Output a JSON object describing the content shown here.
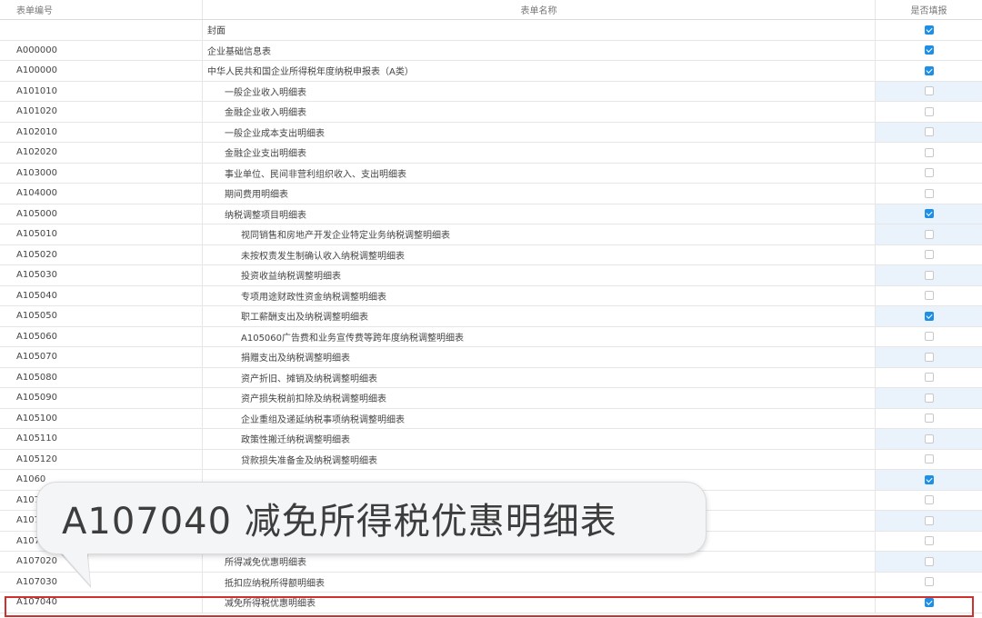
{
  "header": {
    "code": "表单编号",
    "name": "表单名称",
    "filled": "是否填报"
  },
  "rows": [
    {
      "code": "",
      "name": "封面",
      "level": 0,
      "checked": true
    },
    {
      "code": "A000000",
      "name": "企业基础信息表",
      "level": 0,
      "checked": true
    },
    {
      "code": "A100000",
      "name": "中华人民共和国企业所得税年度纳税申报表（A类）",
      "level": 0,
      "checked": true
    },
    {
      "code": "A101010",
      "name": "一般企业收入明细表",
      "level": 1,
      "checked": false
    },
    {
      "code": "A101020",
      "name": "金融企业收入明细表",
      "level": 1,
      "checked": false
    },
    {
      "code": "A102010",
      "name": "一般企业成本支出明细表",
      "level": 1,
      "checked": false
    },
    {
      "code": "A102020",
      "name": "金融企业支出明细表",
      "level": 1,
      "checked": false
    },
    {
      "code": "A103000",
      "name": "事业单位、民间非营利组织收入、支出明细表",
      "level": 1,
      "checked": false
    },
    {
      "code": "A104000",
      "name": "期间费用明细表",
      "level": 1,
      "checked": false
    },
    {
      "code": "A105000",
      "name": "纳税调整项目明细表",
      "level": 1,
      "checked": true
    },
    {
      "code": "A105010",
      "name": "视同销售和房地产开发企业特定业务纳税调整明细表",
      "level": 2,
      "checked": false
    },
    {
      "code": "A105020",
      "name": "未按权责发生制确认收入纳税调整明细表",
      "level": 2,
      "checked": false
    },
    {
      "code": "A105030",
      "name": "投资收益纳税调整明细表",
      "level": 2,
      "checked": false
    },
    {
      "code": "A105040",
      "name": "专项用途财政性资金纳税调整明细表",
      "level": 2,
      "checked": false
    },
    {
      "code": "A105050",
      "name": "职工薪酬支出及纳税调整明细表",
      "level": 2,
      "checked": true
    },
    {
      "code": "A105060",
      "name": "A105060广告费和业务宣传费等跨年度纳税调整明细表",
      "level": 2,
      "checked": false
    },
    {
      "code": "A105070",
      "name": "捐赠支出及纳税调整明细表",
      "level": 2,
      "checked": false
    },
    {
      "code": "A105080",
      "name": "资产折旧、摊销及纳税调整明细表",
      "level": 2,
      "checked": false
    },
    {
      "code": "A105090",
      "name": "资产损失税前扣除及纳税调整明细表",
      "level": 2,
      "checked": false
    },
    {
      "code": "A105100",
      "name": "企业重组及递延纳税事项纳税调整明细表",
      "level": 2,
      "checked": false
    },
    {
      "code": "A105110",
      "name": "政策性搬迁纳税调整明细表",
      "level": 2,
      "checked": false
    },
    {
      "code": "A105120",
      "name": "贷款损失准备金及纳税调整明细表",
      "level": 2,
      "checked": false
    },
    {
      "code": "A1060",
      "name": "",
      "level": 1,
      "checked": true
    },
    {
      "code": "A107",
      "name": "",
      "level": 1,
      "checked": false
    },
    {
      "code": "A107",
      "name": "",
      "level": 1,
      "checked": false
    },
    {
      "code": "A107",
      "name": "",
      "level": 1,
      "checked": false
    },
    {
      "code": "A107020",
      "name": "所得减免优惠明细表",
      "level": 1,
      "checked": false
    },
    {
      "code": "A107030",
      "name": "抵扣应纳税所得额明细表",
      "level": 1,
      "checked": false
    },
    {
      "code": "A107040",
      "name": "减免所得税优惠明细表",
      "level": 1,
      "checked": true
    }
  ],
  "callout": {
    "text": "A107040  减免所得税优惠明细表"
  },
  "colors": {
    "checkbox_on": "#1e8fe6",
    "highlight_border": "#d0312d",
    "shaded_cell": "#eaf3fb"
  }
}
